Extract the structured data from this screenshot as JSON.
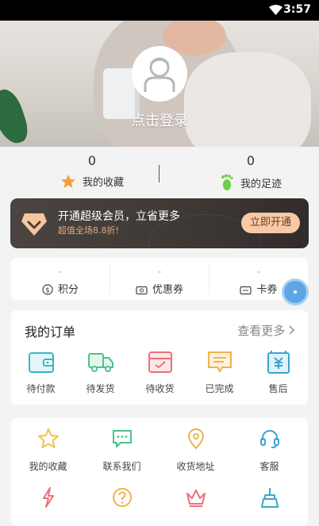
{
  "status_bar": {
    "time": "3:57"
  },
  "profile": {
    "login_text": "点击登录"
  },
  "stats": [
    {
      "count": "0",
      "label": "我的收藏",
      "icon": "star-icon"
    },
    {
      "count": "0",
      "label": "我的足迹",
      "icon": "footprint-icon"
    }
  ],
  "vip_banner": {
    "title": "开通超级会员，立省更多",
    "subtitle": "超值全场8.8折!",
    "button": "立即开通"
  },
  "points_bar": [
    {
      "value": "-",
      "label": "积分",
      "icon": "coin-icon"
    },
    {
      "value": "-",
      "label": "优惠券",
      "icon": "coupon-icon"
    },
    {
      "value": "-",
      "label": "卡券",
      "icon": "card-coupon-icon"
    }
  ],
  "orders": {
    "title": "我的订单",
    "more": "查看更多",
    "items": [
      {
        "label": "待付款",
        "icon": "wallet-icon",
        "color": "#38b6c9"
      },
      {
        "label": "待发货",
        "icon": "truck-icon",
        "color": "#4cc28a"
      },
      {
        "label": "待收货",
        "icon": "box-icon",
        "color": "#e8727a"
      },
      {
        "label": "已完成",
        "icon": "message-check-icon",
        "color": "#f0b24b"
      },
      {
        "label": "售后",
        "icon": "yuan-doc-icon",
        "color": "#3aa6cf"
      }
    ]
  },
  "tools": {
    "items": [
      {
        "label": "我的收藏",
        "icon": "star-outline-icon",
        "color": "#f2c24a"
      },
      {
        "label": "联系我们",
        "icon": "chat-icon",
        "color": "#4cc28a"
      },
      {
        "label": "收货地址",
        "icon": "location-icon",
        "color": "#f0b24b"
      },
      {
        "label": "客服",
        "icon": "headset-icon",
        "color": "#3aa6cf"
      },
      {
        "label": "",
        "icon": "lightning-icon",
        "color": "#e8727a"
      },
      {
        "label": "",
        "icon": "help-icon",
        "color": "#f0b24b"
      },
      {
        "label": "",
        "icon": "crown-icon",
        "color": "#e8727a"
      },
      {
        "label": "",
        "icon": "broom-icon",
        "color": "#3aa6cf"
      }
    ]
  }
}
